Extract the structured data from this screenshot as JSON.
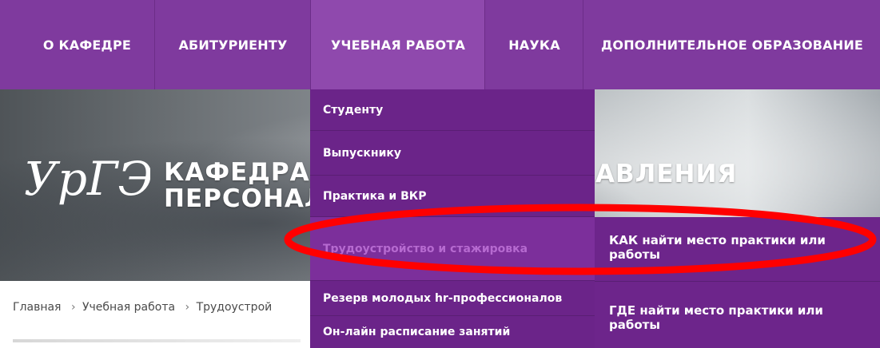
{
  "nav": {
    "items": [
      {
        "label": "О КАФЕДРЕ"
      },
      {
        "label": "АБИТУРИЕНТУ"
      },
      {
        "label": "УЧЕБНАЯ РАБОТА"
      },
      {
        "label": "НАУКА"
      },
      {
        "label": "ДОПОЛНИТЕЛЬНОЕ ОБРАЗОВАНИЕ"
      }
    ]
  },
  "hero": {
    "logo_text": "УрГЭУ",
    "title_line1": "КАФЕДРА ЭК",
    "title_line1_end": "АВЛЕНИЯ",
    "title_line2": "ПЕРСОНАЛО"
  },
  "dropdown": {
    "items": [
      {
        "label": "Студенту"
      },
      {
        "label": "Выпускнику"
      },
      {
        "label": "Практика и ВКР"
      },
      {
        "label": "Трудоустройство и стажировка"
      },
      {
        "label": "Резерв молодых hr-профессионалов"
      },
      {
        "label": "Он-лайн расписание занятий"
      }
    ]
  },
  "submenu": {
    "items": [
      {
        "label": "КАК найти место практики или работы"
      },
      {
        "label": "ГДЕ найти место практики или работы"
      }
    ]
  },
  "breadcrumb": {
    "items": [
      "Главная",
      "Учебная работа",
      "Трудоустрой"
    ]
  },
  "colors": {
    "nav_bg": "#7f3a9e",
    "dropdown_bg": "#6b2489",
    "annotation": "#ff0000"
  }
}
